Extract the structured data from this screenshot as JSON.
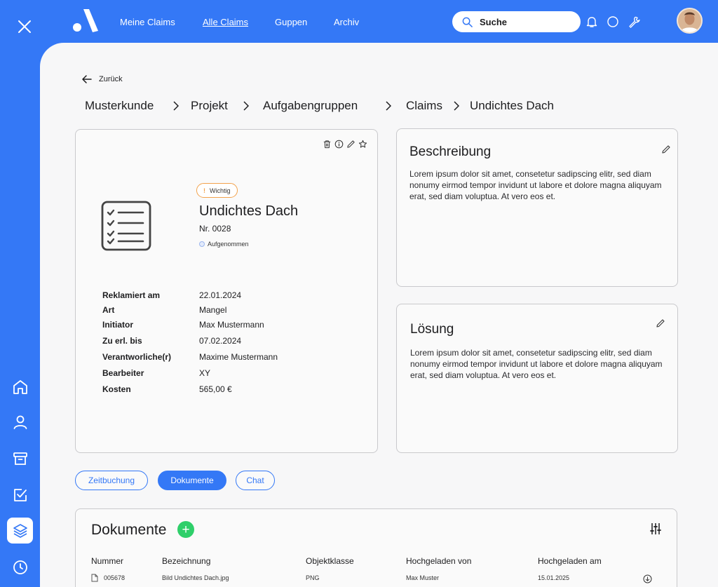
{
  "topnav": {
    "items": [
      {
        "label": "Meine Claims",
        "current": false
      },
      {
        "label": "Alle Claims",
        "current": true
      },
      {
        "label": "Guppen",
        "current": false
      },
      {
        "label": "Archiv",
        "current": false
      }
    ],
    "search_label": "Suche"
  },
  "rail": {
    "icons": [
      "close-icon",
      "home-icon",
      "user-icon",
      "archive-icon",
      "checkbox-icon",
      "layers-icon",
      "clock-icon"
    ],
    "active": "layers-icon"
  },
  "back_label": "Zurück",
  "breadcrumb": [
    "Musterkunde",
    "Projekt",
    "Aufgabengruppen",
    "Claims",
    "Undichtes Dach"
  ],
  "claim": {
    "badge": "Wichtig",
    "title": "Undichtes Dach",
    "number": "Nr. 0028",
    "status": "Aufgenommen",
    "details": [
      {
        "key": "Reklamiert am",
        "value": "22.01.2024"
      },
      {
        "key": "Art",
        "value": "Mangel"
      },
      {
        "key": "Initiator",
        "value": "Max Mustermann"
      },
      {
        "key": "Zu erl. bis",
        "value": "07.02.2024"
      },
      {
        "key": "Verantworliche(r)",
        "value": "Maxime Mustermann"
      },
      {
        "key": "Bearbeiter",
        "value": "XY"
      },
      {
        "key": "Kosten",
        "value": "565,00 €"
      }
    ]
  },
  "beschreibung": {
    "title": "Beschreibung",
    "text": "Lorem ipsum dolor sit amet, consetetur sadipscing elitr, sed diam nonumy eirmod tempor invidunt ut labore et dolore magna aliquyam erat, sed diam voluptua. At vero eos et."
  },
  "loesung": {
    "title": "Lösung",
    "text": "Lorem ipsum dolor sit amet, consetetur sadipscing elitr, sed diam nonumy eirmod tempor invidunt ut labore et dolore magna aliquyam erat, sed diam voluptua. At vero eos et."
  },
  "tabs": [
    {
      "label": "Zeitbuchung",
      "active": false
    },
    {
      "label": "Dokumente",
      "active": true
    },
    {
      "label": "Chat",
      "active": false
    }
  ],
  "documents": {
    "title": "Dokumente",
    "add_label": "+",
    "columns": [
      "Nummer",
      "Bezeichnung",
      "Objektklasse",
      "Hochgeladen von",
      "Hochgeladen am"
    ],
    "rows": [
      [
        "005678",
        "Bild Undichtes Dach.jpg",
        "PNG",
        "Max Muster",
        "15.01.2025"
      ]
    ]
  },
  "colors": {
    "brand": "#3478F6",
    "badge": "#F2A24C",
    "add": "#2FCF6A"
  }
}
